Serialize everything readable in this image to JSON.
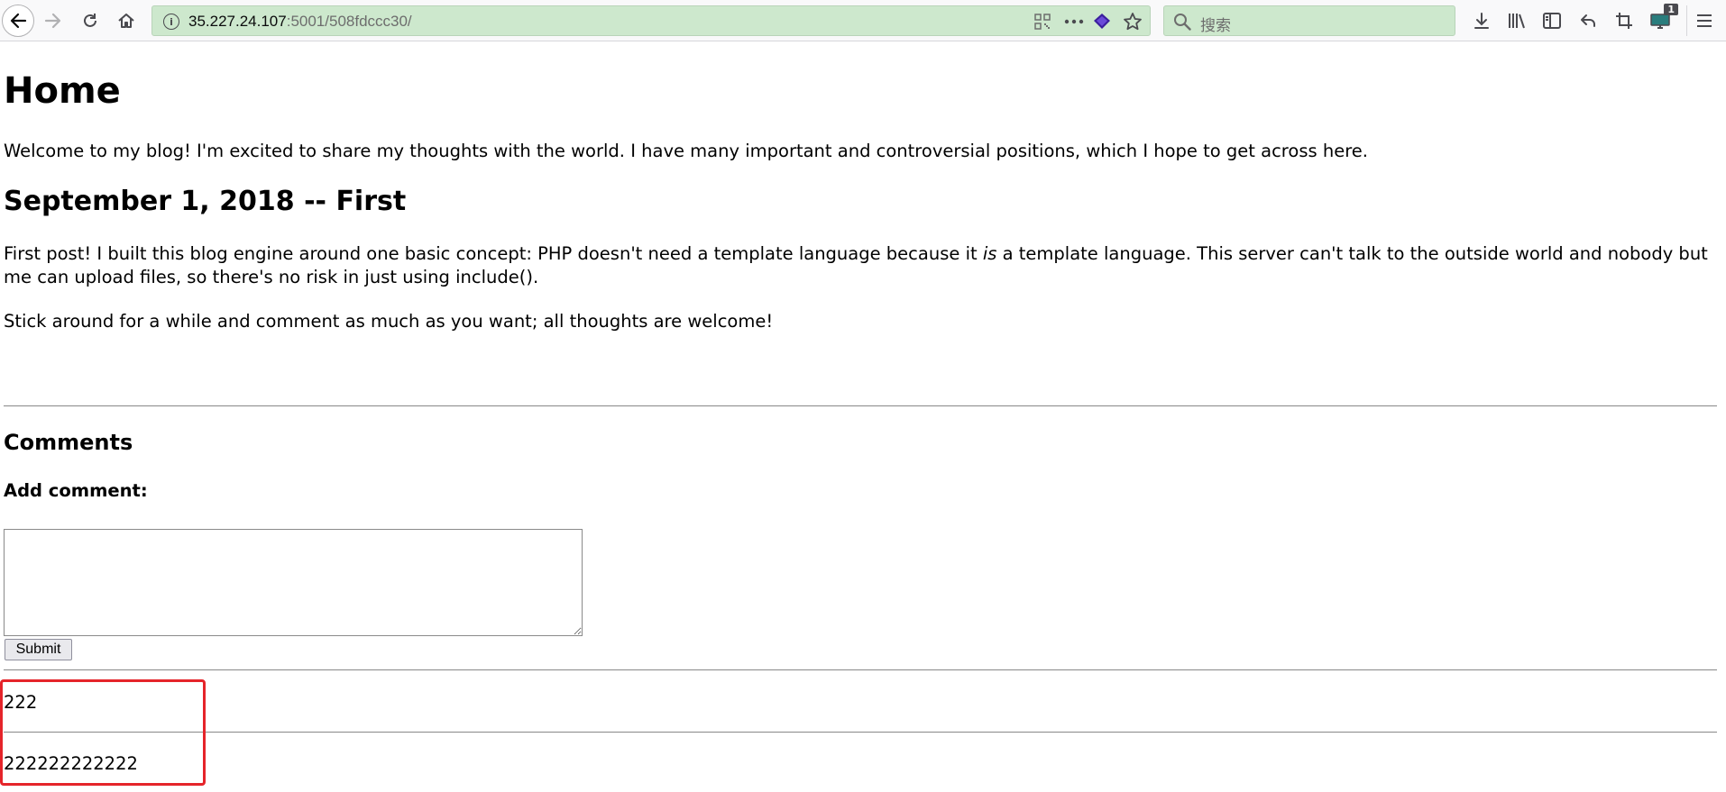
{
  "browser": {
    "url_host": "35.227.24.107",
    "url_path": ":5001/508fdccc30/",
    "search_placeholder": "搜索",
    "tabs_badge": "1",
    "accent_color": "#cde8cd"
  },
  "page": {
    "title": "Home",
    "intro": "Welcome to my blog! I'm excited to share my thoughts with the world. I have many important and controversial positions, which I hope to get across here.",
    "post": {
      "heading": "September 1, 2018 -- First",
      "p1_before": "First post! I built this blog engine around one basic concept: PHP doesn't need a template language because it ",
      "p1_em": "is",
      "p1_after": " a template language. This server can't talk to the outside world and nobody but me can upload files, so there's no risk in just using include().",
      "p2": "Stick around for a while and comment as much as you want; all thoughts are welcome!"
    },
    "comments": {
      "heading": "Comments",
      "add_label": "Add comment:",
      "textarea_value": "",
      "submit_label": "Submit",
      "items": [
        "222",
        "222222222222"
      ]
    },
    "highlight_color": "#e5242a"
  }
}
